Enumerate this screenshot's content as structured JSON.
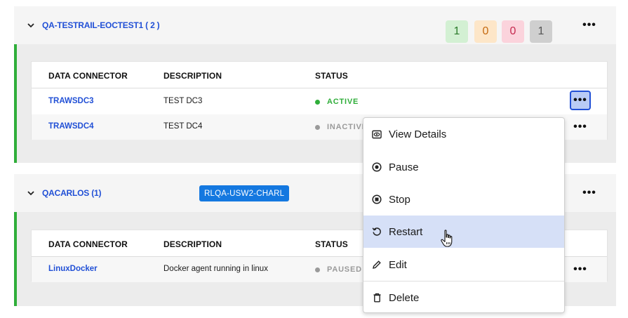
{
  "groups": [
    {
      "title": "QA-TESTRAIL-EOCTEST1 ( 2 )",
      "tag": "",
      "counts": [
        {
          "value": "1",
          "bg": "#d3f0d3",
          "fg": "#2b7a2b"
        },
        {
          "value": "0",
          "bg": "#fde6c8",
          "fg": "#c56a10"
        },
        {
          "value": "0",
          "bg": "#fbd3dc",
          "fg": "#c52a4f"
        },
        {
          "value": "1",
          "bg": "#cfcfcf",
          "fg": "#555555"
        }
      ],
      "columns": [
        "DATA CONNECTOR",
        "DESCRIPTION",
        "STATUS"
      ],
      "rows": [
        {
          "name": "TRAWSDC3",
          "description": "TEST DC3",
          "status": "ACTIVE",
          "status_color": "#2fae3a"
        },
        {
          "name": "TRAWSDC4",
          "description": "TEST DC4",
          "status": "INACTIVE",
          "status_color": "#9a9a9a"
        }
      ]
    },
    {
      "title": "QACARLOS (1)",
      "tag": "RLQA-USW2-CHARL",
      "columns": [
        "DATA CONNECTOR",
        "DESCRIPTION",
        "STATUS"
      ],
      "rows": [
        {
          "name": "LinuxDocker",
          "description": "Docker agent running in linux",
          "status": "PAUSED",
          "status_color": "#9a9a9a"
        }
      ]
    }
  ],
  "more_glyph": "•••",
  "menu": {
    "items": [
      {
        "label": "View Details",
        "icon": "eye-icon"
      },
      {
        "label": "Pause",
        "icon": "pause-circle-icon"
      },
      {
        "label": "Stop",
        "icon": "stop-circle-icon"
      },
      {
        "label": "Restart",
        "icon": "restart-icon",
        "hover": true
      },
      {
        "label": "Edit",
        "icon": "pencil-icon"
      },
      {
        "label": "Delete",
        "icon": "trash-icon"
      }
    ]
  },
  "colors": {
    "link": "#2150d6",
    "accent_bar": "#2fae3a",
    "tag_bg": "#1478e0",
    "menu_hover": "#d6e0f7"
  }
}
